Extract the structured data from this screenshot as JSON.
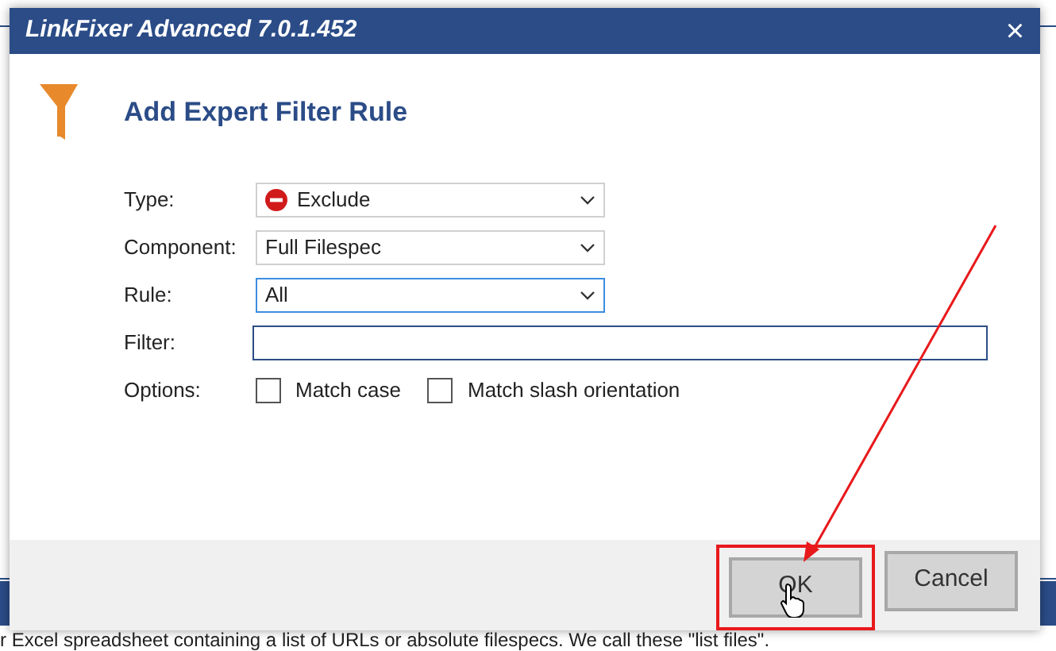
{
  "window": {
    "title": "LinkFixer Advanced 7.0.1.452",
    "close": "×"
  },
  "heading": "Add Expert Filter Rule",
  "fields": [
    {
      "kind": "icon_select",
      "label": "Type:",
      "value": "Exclude",
      "focused": false
    },
    {
      "kind": "select",
      "label": "Component:",
      "value": "Full Filespec",
      "focused": false
    },
    {
      "kind": "select",
      "label": "Rule:",
      "value": "All",
      "focused": true
    },
    {
      "kind": "text",
      "label": "Filter:"
    },
    {
      "kind": "checkboxes",
      "label": "Options:",
      "options": [
        {
          "label": "Match case",
          "checked": false
        },
        {
          "label": "Match slash orientation",
          "checked": false
        }
      ]
    }
  ],
  "buttons": [
    {
      "label": "OK",
      "highlighted": true
    },
    {
      "label": "Cancel",
      "highlighted": false
    }
  ],
  "background_text": "r Excel spreadsheet containing a list of URLs or absolute filespecs. We call these \"list files\"."
}
